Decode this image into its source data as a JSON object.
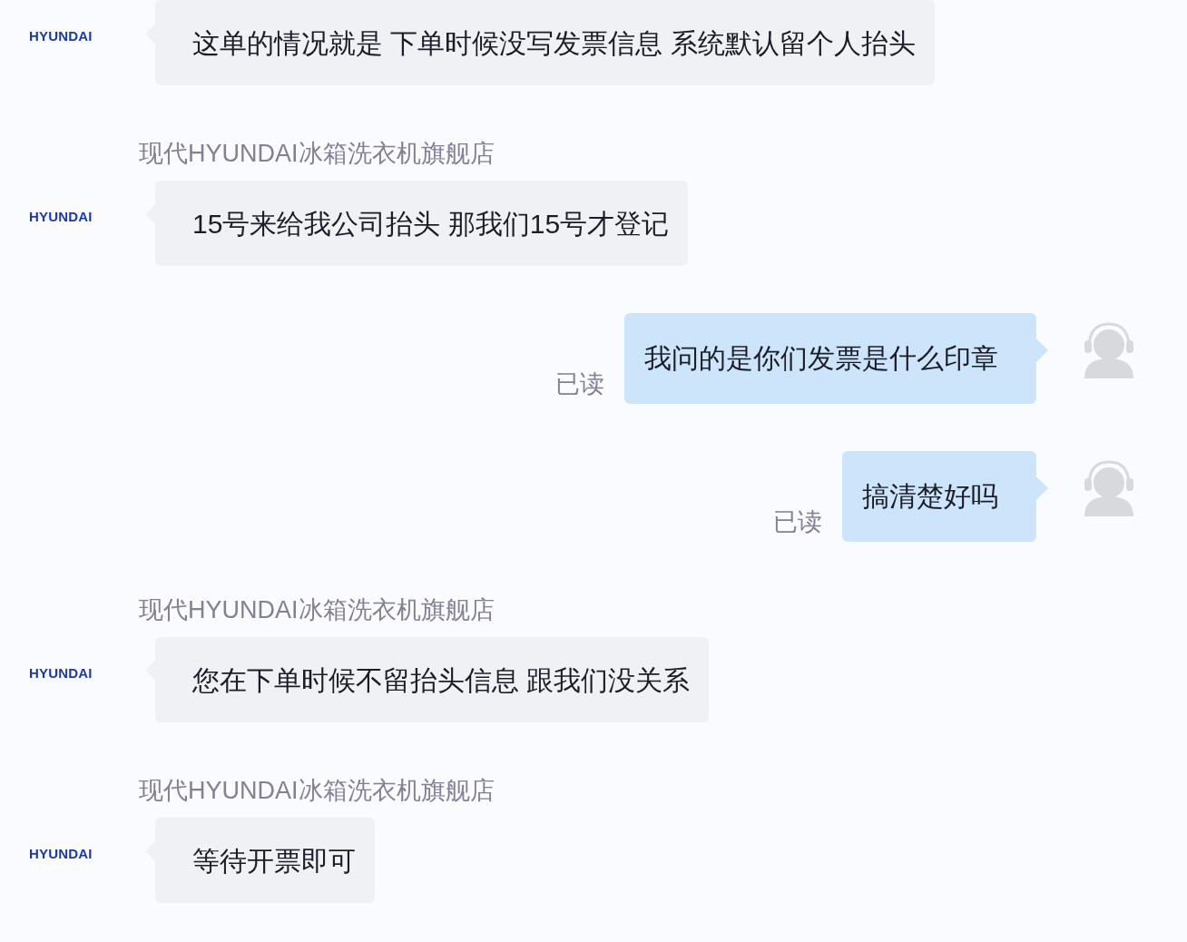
{
  "messages": [
    {
      "kind": "incoming",
      "avatar": "HYUNDAI",
      "text": "这单的情况就是 下单时候没写发票信息 系统默认留个人抬头"
    },
    {
      "kind": "incoming",
      "sender": "现代HYUNDAI冰箱洗衣机旗舰店",
      "avatar": "HYUNDAI",
      "text": "15号来给我公司抬头 那我们15号才登记"
    },
    {
      "kind": "outgoing",
      "status": "已读",
      "text": "我问的是你们发票是什么印章"
    },
    {
      "kind": "outgoing",
      "status": "已读",
      "text": "搞清楚好吗"
    },
    {
      "kind": "incoming",
      "sender": "现代HYUNDAI冰箱洗衣机旗舰店",
      "avatar": "HYUNDAI",
      "text": "您在下单时候不留抬头信息 跟我们没关系"
    },
    {
      "kind": "incoming",
      "sender": "现代HYUNDAI冰箱洗衣机旗舰店",
      "avatar": "HYUNDAI",
      "text": "等待开票即可"
    }
  ]
}
